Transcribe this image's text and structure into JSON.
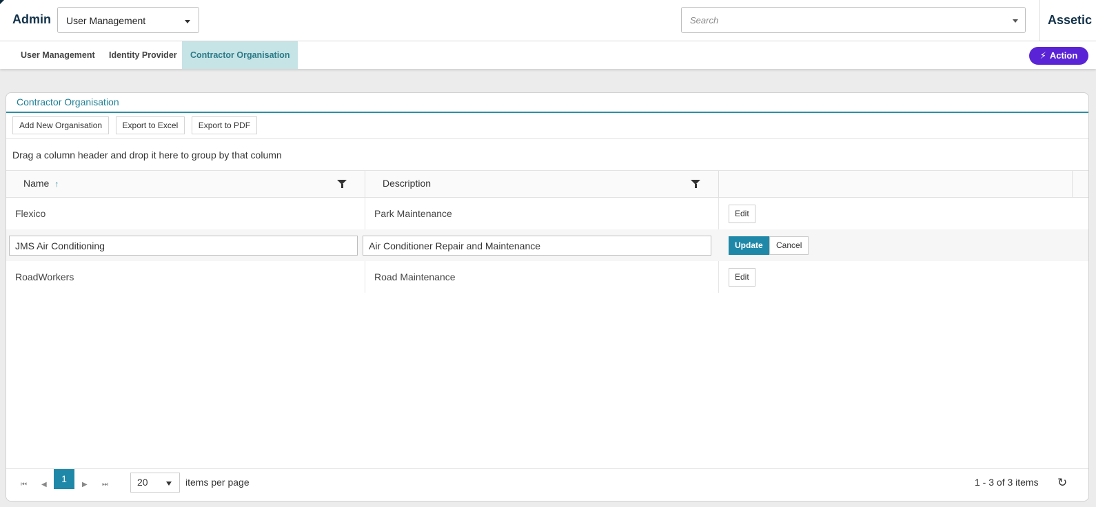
{
  "header": {
    "app_title": "Admin",
    "module_select": "User Management",
    "search_placeholder": "Search",
    "brand": "Assetic"
  },
  "tabs": {
    "user_management": "User Management",
    "identity_provider": "Identity Provider",
    "contractor_organisation": "Contractor Organisation",
    "active": "Contractor Organisation"
  },
  "action_button": {
    "label": "Action",
    "icon": "bolt-icon",
    "color": "#5a24d6"
  },
  "panel": {
    "title": "Contractor Organisation",
    "toolbar": {
      "add": "Add New Organisation",
      "excel": "Export to Excel",
      "pdf": "Export to PDF"
    },
    "group_hint": "Drag a column header and drop it here to group by that column"
  },
  "grid": {
    "columns": {
      "name": "Name",
      "description": "Description"
    },
    "sort": {
      "column": "Name",
      "direction": "ascending"
    },
    "rows": [
      {
        "name": "Flexico",
        "description": "Park Maintenance",
        "edit": "Edit"
      },
      {
        "name": "JMS Air Conditioning",
        "description": "Air Conditioner Repair and Maintenance",
        "update": "Update",
        "cancel": "Cancel"
      },
      {
        "name": "RoadWorkers",
        "description": "Road Maintenance",
        "edit": "Edit"
      }
    ]
  },
  "pager": {
    "current_page": "1",
    "page_size": "20",
    "page_size_label": "items per page",
    "info": "1 - 3 of 3 items"
  },
  "colors": {
    "accent": "#1f88a8",
    "active_tab_bg": "#c6e3e6",
    "action": "#5a24d6"
  }
}
